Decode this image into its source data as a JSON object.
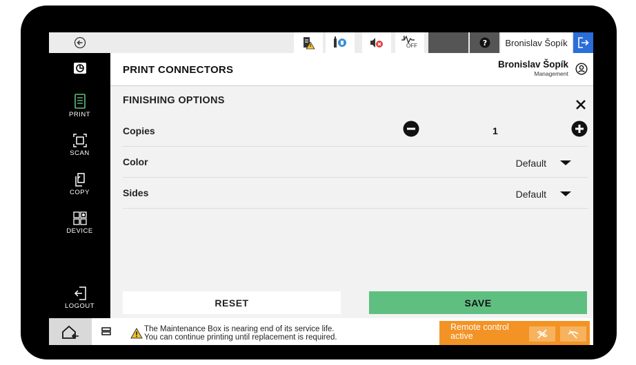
{
  "topbar": {
    "back_icon": "back-arrow-icon",
    "status_icons": [
      "supplies-warning-icon",
      "toner-status-icon",
      "sound-muted-icon",
      "energy-off-icon"
    ],
    "energy_off_label": "OFF",
    "sleep_icon": "moon-icon",
    "help_icon": "help-icon",
    "user_name": "Bronislav Šopík",
    "signout_icon": "sign-out-icon"
  },
  "sidebar": {
    "logo_icon": "printer-logo-icon",
    "items": [
      {
        "label": "PRINT",
        "icon": "print-icon",
        "active": true
      },
      {
        "label": "SCAN",
        "icon": "scan-icon"
      },
      {
        "label": "COPY",
        "icon": "copy-icon"
      },
      {
        "label": "DEVICE",
        "icon": "device-icon"
      }
    ],
    "logout_label": "LOGOUT",
    "logout_icon": "logout-icon"
  },
  "header": {
    "title": "PRINT CONNECTORS",
    "user_name": "Bronislav Šopík",
    "user_role": "Management",
    "avatar_icon": "user-avatar-icon"
  },
  "main": {
    "section_title": "FINISHING OPTIONS",
    "close_icon": "close-icon",
    "copies": {
      "label": "Copies",
      "value": "1"
    },
    "color": {
      "label": "Color",
      "value": "Default"
    },
    "sides": {
      "label": "Sides",
      "value": "Default"
    }
  },
  "actions": {
    "reset_label": "RESET",
    "save_label": "SAVE"
  },
  "bottombar": {
    "home_icon": "home-icon",
    "jobs_icon": "job-list-icon",
    "message_line1": "The Maintenance Box is nearing end of its service life.",
    "message_line2": "You can continue printing until replacement is required.",
    "remote_text": "Remote control active",
    "remote_disconnect_icon": "disconnect-icon",
    "remote_hide_icon": "hide-icon"
  },
  "colors": {
    "save": "#5fbf80",
    "remote": "#f39325",
    "signout": "#2b6dd9",
    "sidebar": "#000000"
  }
}
